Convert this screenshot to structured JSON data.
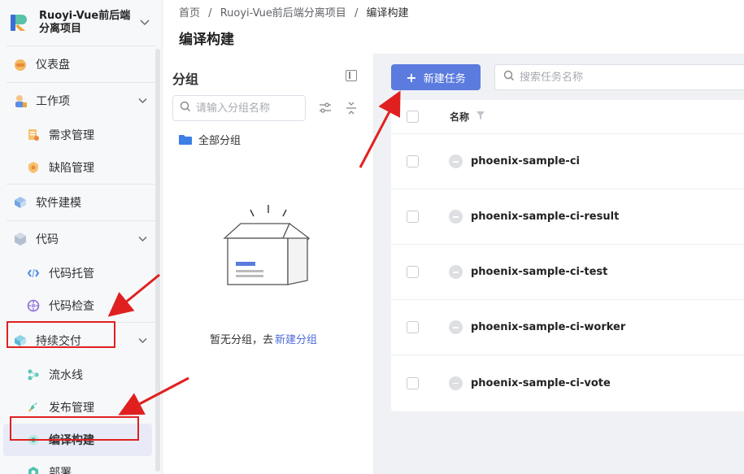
{
  "brand": {
    "name_line1": "Ruoyi-Vue前后端",
    "name_line2": "分离项目"
  },
  "sidebar": {
    "items": [
      {
        "label": "仪表盘",
        "icon": "dashboard-icon"
      },
      {
        "label": "工作项",
        "icon": "workitem-icon"
      },
      {
        "label": "需求管理",
        "icon": "requirement-icon"
      },
      {
        "label": "缺陷管理",
        "icon": "bug-icon"
      },
      {
        "label": "软件建模",
        "icon": "modeling-icon"
      },
      {
        "label": "代码",
        "icon": "code-icon"
      },
      {
        "label": "代码托管",
        "icon": "code-hosting-icon"
      },
      {
        "label": "代码检查",
        "icon": "code-check-icon"
      },
      {
        "label": "持续交付",
        "icon": "delivery-icon"
      },
      {
        "label": "流水线",
        "icon": "pipeline-icon"
      },
      {
        "label": "发布管理",
        "icon": "release-icon"
      },
      {
        "label": "编译构建",
        "icon": "build-icon"
      },
      {
        "label": "部署",
        "icon": "deploy-icon"
      }
    ]
  },
  "header": {
    "breadcrumb": [
      "首页",
      "/",
      "Ruoyi-Vue前后端分离项目",
      "/",
      "编译构建"
    ],
    "title": "编译构建"
  },
  "groups": {
    "title": "分组",
    "search_placeholder": "请输入分组名称",
    "all_label": "全部分组",
    "empty_text": "暂无分组，去",
    "empty_link": "新建分组"
  },
  "main": {
    "new_task_label": "新建任务",
    "search_placeholder": "搜索任务名称",
    "column_name": "名称",
    "tasks": [
      "phoenix-sample-ci",
      "phoenix-sample-ci-result",
      "phoenix-sample-ci-test",
      "phoenix-sample-ci-worker",
      "phoenix-sample-ci-vote"
    ]
  },
  "colors": {
    "accent": "#5b7bde",
    "annotation": "#e02020"
  }
}
